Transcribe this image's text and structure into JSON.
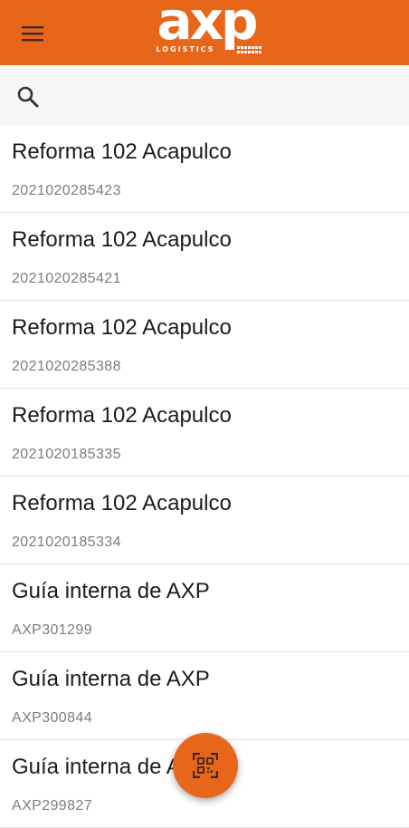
{
  "app": {
    "logo_text": "axp",
    "logo_tagline": "LOGISTICS",
    "brand_color": "#e8661a"
  },
  "icons": {
    "menu": "menu-icon",
    "search": "search-icon",
    "scan": "qr-scan-icon"
  },
  "search": {
    "value": "",
    "placeholder": ""
  },
  "items": [
    {
      "title": "Reforma 102 Acapulco",
      "subtitle": "2021020285423"
    },
    {
      "title": "Reforma 102 Acapulco",
      "subtitle": "2021020285421"
    },
    {
      "title": "Reforma 102 Acapulco",
      "subtitle": "2021020285388"
    },
    {
      "title": "Reforma 102 Acapulco",
      "subtitle": "2021020185335"
    },
    {
      "title": "Reforma 102 Acapulco",
      "subtitle": "2021020185334"
    },
    {
      "title": "Guía interna de AXP",
      "subtitle": "AXP301299"
    },
    {
      "title": "Guía interna de AXP",
      "subtitle": "AXP300844"
    },
    {
      "title": "Guía interna de AXP",
      "subtitle": "AXP299827"
    }
  ]
}
